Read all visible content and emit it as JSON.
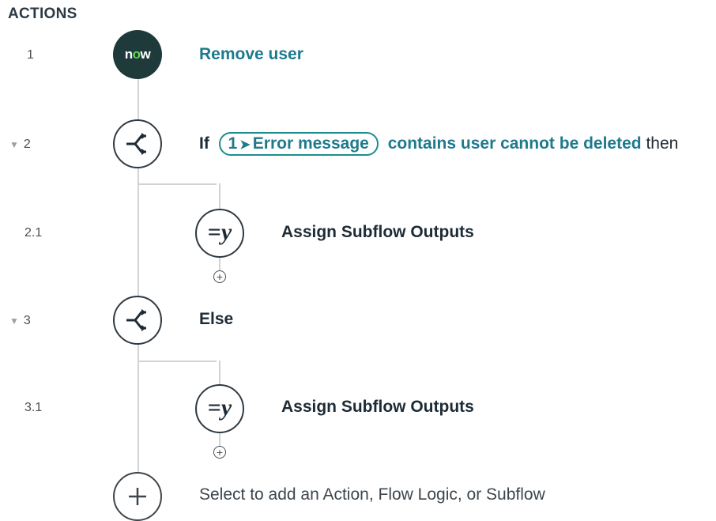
{
  "section": {
    "title": "ACTIONS"
  },
  "steps": [
    {
      "number": "1",
      "label": "Remove user"
    },
    {
      "number": "2",
      "if_keyword": "If",
      "pill_step": "1",
      "pill_label": "Error message",
      "condition": "contains user cannot be deleted",
      "then_keyword": "then"
    },
    {
      "number": "2.1",
      "label": "Assign Subflow Outputs"
    },
    {
      "number": "3",
      "label": "Else"
    },
    {
      "number": "3.1",
      "label": "Assign Subflow Outputs"
    }
  ],
  "add_action": {
    "label": "Select to add an Action, Flow Logic, or Subflow"
  },
  "icons": {
    "now_logo": "now",
    "branch": "branch-icon",
    "assign": "=y",
    "add": "+"
  },
  "colors": {
    "link": "#1e7a8c",
    "pill_border": "#1e8c8c",
    "now_bg": "#1f3a3a",
    "now_accent": "#62d84e",
    "connector": "#cfd3d6"
  }
}
